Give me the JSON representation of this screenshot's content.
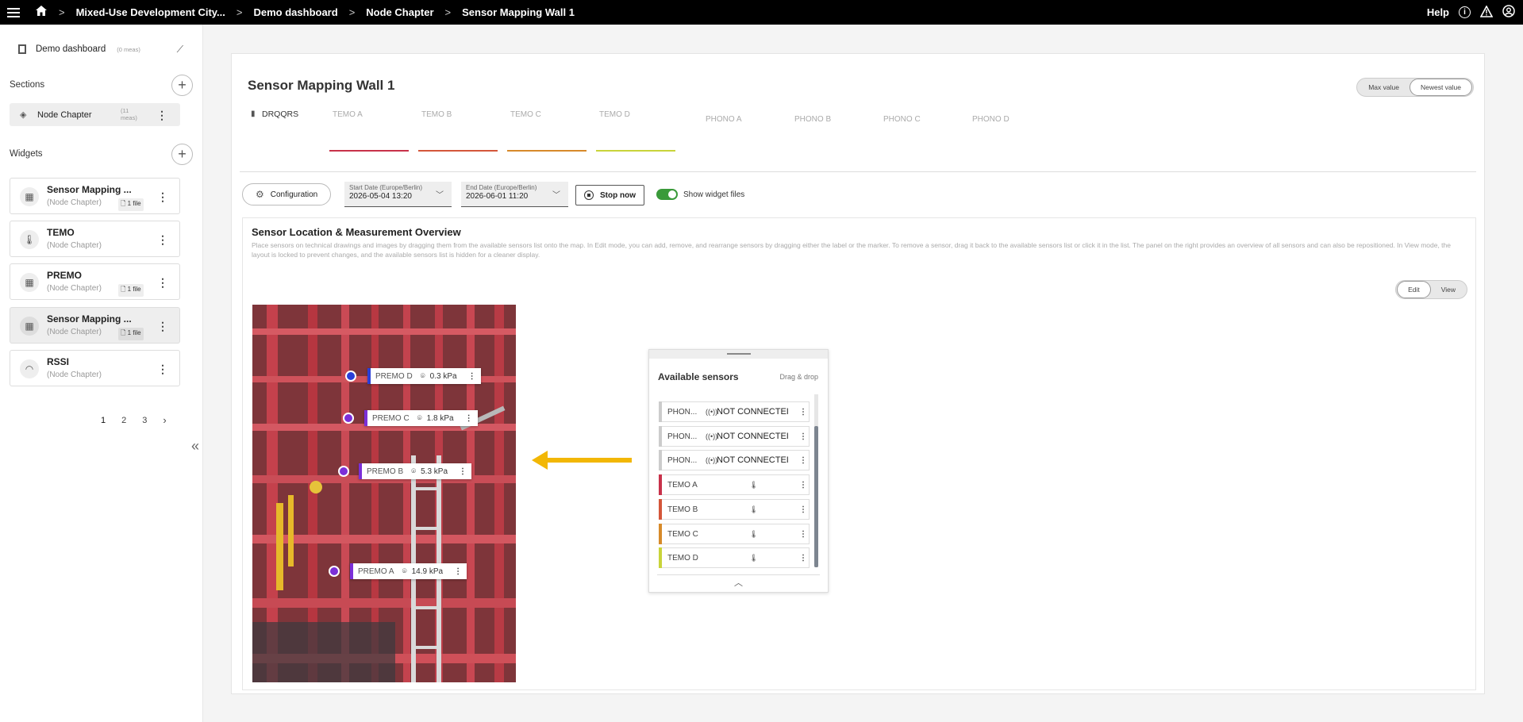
{
  "topbar": {
    "breadcrumbs": [
      "Mixed-Use Development City...",
      "Demo dashboard",
      "Node Chapter",
      "Sensor Mapping Wall 1"
    ],
    "help_label": "Help"
  },
  "sidebar": {
    "dashboard_label": "Demo dashboard",
    "dashboard_meta": "(0 meas)",
    "sections_label": "Sections",
    "section_item": {
      "label": "Node Chapter",
      "meta": "(11 meas)"
    },
    "widgets_label": "Widgets",
    "widgets": [
      {
        "name": "Sensor Mapping ...",
        "sub": "(Node Chapter)",
        "file": "1 file",
        "icon": "grid-icon"
      },
      {
        "name": "TEMO",
        "sub": "(Node Chapter)",
        "file": "",
        "icon": "thermometer-icon"
      },
      {
        "name": "PREMO",
        "sub": "(Node Chapter)",
        "file": "1 file",
        "icon": "grid-icon"
      },
      {
        "name": "Sensor Mapping ...",
        "sub": "(Node Chapter)",
        "file": "1 file",
        "icon": "grid-icon"
      },
      {
        "name": "RSSI",
        "sub": "(Node Chapter)",
        "file": "",
        "icon": "wifi-icon"
      }
    ],
    "pages": [
      "1",
      "2",
      "3"
    ]
  },
  "main": {
    "title": "Sensor Mapping Wall 1",
    "value_toggle": {
      "options": [
        "Max value",
        "Newest value"
      ],
      "selected": "Newest value"
    },
    "device": "DRQQRS",
    "tabs": [
      {
        "label": "TEMO A",
        "color": "#c8324a"
      },
      {
        "label": "TEMO B",
        "color": "#d4563a"
      },
      {
        "label": "TEMO C",
        "color": "#d78a2a"
      },
      {
        "label": "TEMO D",
        "color": "#c9d43a"
      },
      {
        "label": "PHONO A",
        "color": ""
      },
      {
        "label": "PHONO B",
        "color": ""
      },
      {
        "label": "PHONO C",
        "color": ""
      },
      {
        "label": "PHONO D",
        "color": ""
      }
    ],
    "configuration_label": "Configuration",
    "start_date": {
      "label": "Start Date (Europe/Berlin)",
      "value": "2026-05-04 13:20"
    },
    "end_date": {
      "label": "End Date (Europe/Berlin)",
      "value": "2026-06-01 11:20"
    },
    "stop_label": "Stop now",
    "show_files_label": "Show widget files",
    "show_files_on": true
  },
  "widget": {
    "title": "Sensor Location & Measurement Overview",
    "description": "Place sensors on technical drawings and images by dragging them from the available sensors list onto the map. In Edit mode, you can add, remove, and rearrange sensors by dragging either the label or the marker. To remove a sensor, drag it back to the available sensors list or click it in the list. The panel on the right provides an overview of all sensors and can also be repositioned. In View mode, the layout is locked to prevent changes, and the available sensors list is hidden for a cleaner display.",
    "mode_toggle": {
      "options": [
        "Edit",
        "View"
      ],
      "selected": "Edit"
    },
    "placed_sensors": [
      {
        "name": "PREMO D",
        "value": "0.3 kPa",
        "color": "#2a3fd8"
      },
      {
        "name": "PREMO C",
        "value": "1.8 kPa",
        "color": "#7b2fd8"
      },
      {
        "name": "PREMO B",
        "value": "5.3 kPa",
        "color": "#7b2fd8"
      },
      {
        "name": "PREMO A",
        "value": "14.9 kPa",
        "color": "#7b2fd8"
      }
    ],
    "available": {
      "title": "Available sensors",
      "hint": "Drag & drop",
      "items": [
        {
          "name": "PHON...",
          "status": "NOT CONNECTEI",
          "icon": "signal-icon",
          "color": "#cccccc"
        },
        {
          "name": "PHON...",
          "status": "NOT CONNECTEI",
          "icon": "signal-icon",
          "color": "#cccccc"
        },
        {
          "name": "PHON...",
          "status": "NOT CONNECTEI",
          "icon": "signal-icon",
          "color": "#cccccc"
        },
        {
          "name": "TEMO A",
          "status": "",
          "icon": "thermometer-icon",
          "color": "#c8324a"
        },
        {
          "name": "TEMO B",
          "status": "",
          "icon": "thermometer-icon",
          "color": "#d4563a"
        },
        {
          "name": "TEMO C",
          "status": "",
          "icon": "thermometer-icon",
          "color": "#d78a2a"
        },
        {
          "name": "TEMO D",
          "status": "",
          "icon": "thermometer-icon",
          "color": "#c9d43a"
        }
      ]
    }
  }
}
